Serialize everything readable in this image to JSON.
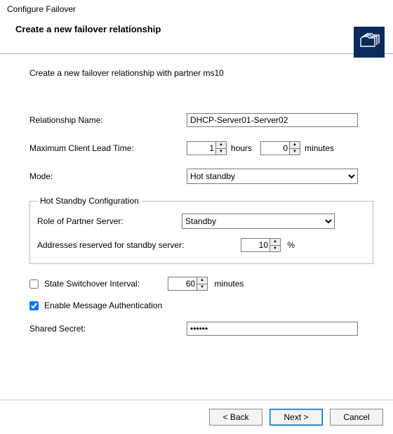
{
  "window": {
    "title": "Configure Failover",
    "subtitle": "Create a new failover relationship"
  },
  "intro": "Create a new failover relationship with partner ms10",
  "labels": {
    "relationship_name": "Relationship Name:",
    "mclt": "Maximum Client Lead Time:",
    "mode": "Mode:",
    "hsc_legend": "Hot Standby Configuration",
    "role": "Role of Partner Server:",
    "reserved": "Addresses reserved for standby server:",
    "switchover": "State Switchover Interval:",
    "enable_msg_auth": "Enable Message Authentication",
    "shared_secret": "Shared Secret:",
    "hours": "hours",
    "minutes": "minutes",
    "percent": "%"
  },
  "values": {
    "relationship_name": "DHCP-Server01-Server02",
    "mclt_hours": "1",
    "mclt_minutes": "0",
    "mode": "Hot standby",
    "role": "Standby",
    "reserved_pct": "10",
    "switchover_checked": false,
    "switchover_minutes": "60",
    "enable_msg_auth_checked": true,
    "shared_secret": "••••••"
  },
  "buttons": {
    "back": "< Back",
    "next": "Next >",
    "cancel": "Cancel"
  }
}
